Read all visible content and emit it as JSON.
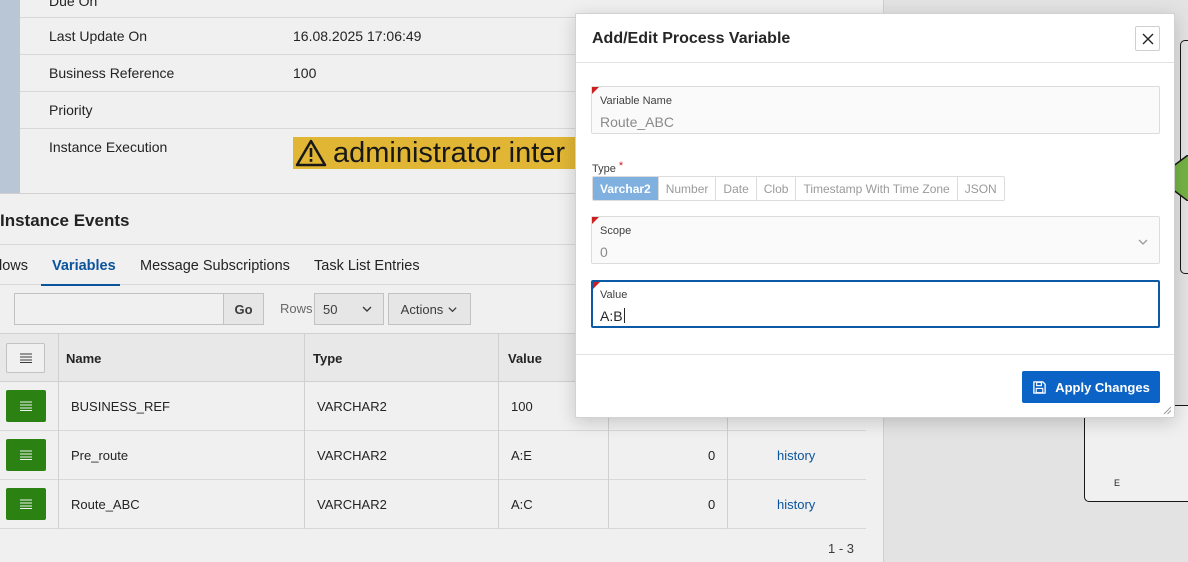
{
  "details": {
    "due_on_label": "Due On",
    "last_update_label": "Last Update On",
    "last_update_value": "16.08.2025 17:06:49",
    "business_ref_label": "Business Reference",
    "business_ref_value": "100",
    "priority_label": "Priority",
    "instance_exec_label": "Instance Execution",
    "instance_exec_banner": "administrator inter"
  },
  "events": {
    "title": "Instance Events",
    "tabs": [
      {
        "label": "lows"
      },
      {
        "label": "Variables",
        "active": true
      },
      {
        "label": "Message Subscriptions"
      },
      {
        "label": "Task List Entries"
      }
    ]
  },
  "toolbar": {
    "go_label": "Go",
    "rows_label": "Rows",
    "rows_value": "50",
    "actions_label": "Actions"
  },
  "grid": {
    "columns": [
      "Name",
      "Type",
      "Value"
    ],
    "rows": [
      {
        "name": "BUSINESS_REF",
        "type": "VARCHAR2",
        "value": "100",
        "scope": "",
        "history": ""
      },
      {
        "name": "Pre_route",
        "type": "VARCHAR2",
        "value": "A:E",
        "scope": "0",
        "history": "history"
      },
      {
        "name": "Route_ABC",
        "type": "VARCHAR2",
        "value": "A:C",
        "scope": "0",
        "history": "history"
      }
    ],
    "pagination": "1 - 3"
  },
  "diagram": {
    "node_label": "E"
  },
  "dialog": {
    "title": "Add/Edit Process Variable",
    "variable_name_label": "Variable Name",
    "variable_name_value": "Route_ABC",
    "type_label": "Type",
    "type_options": [
      "Varchar2",
      "Number",
      "Date",
      "Clob",
      "Timestamp With Time Zone",
      "JSON"
    ],
    "type_selected": "Varchar2",
    "scope_label": "Scope",
    "scope_value": "0",
    "value_label": "Value",
    "value_value": "A:B",
    "apply_label": "Apply Changes"
  },
  "colors": {
    "accent": "#0b63c6",
    "row_button": "#2e8b15",
    "warning": "#f0c239",
    "required": "#cc1f1f"
  }
}
